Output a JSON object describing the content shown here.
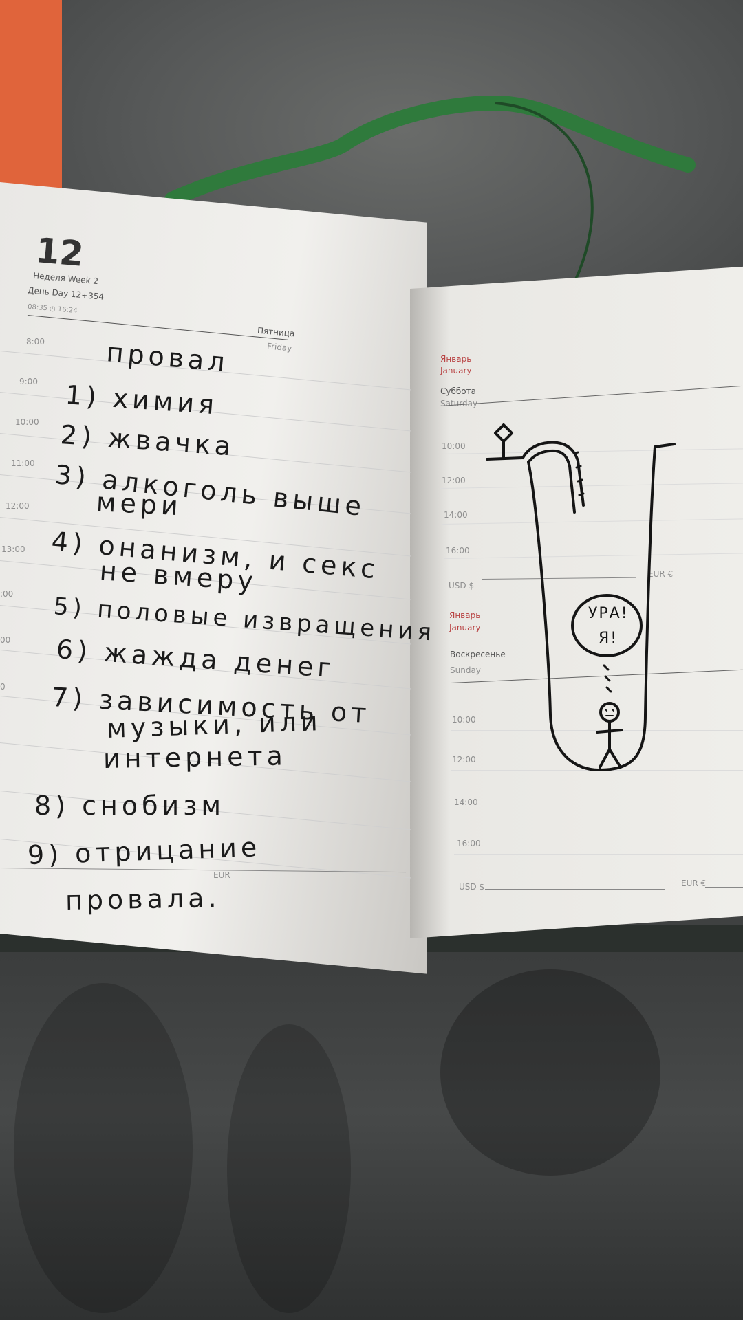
{
  "diary": {
    "day_number": "12",
    "week": "Неделя Week 2",
    "day": "День Day 12+354",
    "sun_times": "08:35 ◷ 16:24",
    "weekday_ru": "Пятница",
    "weekday_en": "Friday",
    "hours_left": [
      "8:00",
      "9:00",
      "10:00",
      "11:00",
      "12:00",
      "13:00",
      ":00",
      "00",
      "0"
    ],
    "right_top": {
      "month_ru": "Январь",
      "month_en": "January",
      "weekday_ru": "Суббота",
      "weekday_en": "Saturday",
      "hours": [
        "10:00",
        "12:00",
        "14:00",
        "16:00"
      ],
      "usd": "USD $",
      "eur": "EUR €"
    },
    "right_bottom": {
      "month_ru": "Январь",
      "month_en": "January",
      "weekday_ru": "Воскресенье",
      "weekday_en": "Sunday",
      "hours": [
        "10:00",
        "12:00",
        "14:00",
        "16:00"
      ],
      "usd": "USD $",
      "eur": "EUR €"
    },
    "left_eur": "EUR"
  },
  "handwriting": {
    "title": "провал",
    "lines": [
      "1) химия",
      "2) жвачка",
      "3) алкоголь выше",
      "мери",
      "4) онанизм, и секс",
      "не вмеру",
      "5) половые извращения",
      "6) жажда денег",
      "7) зависимость от",
      "музыки, или",
      "интернета",
      "8) снобизм",
      "9) отрицание",
      "провала."
    ]
  },
  "drawing": {
    "speech_line1": "УРА!",
    "speech_line2": "Я!",
    "dots": "о о о"
  }
}
